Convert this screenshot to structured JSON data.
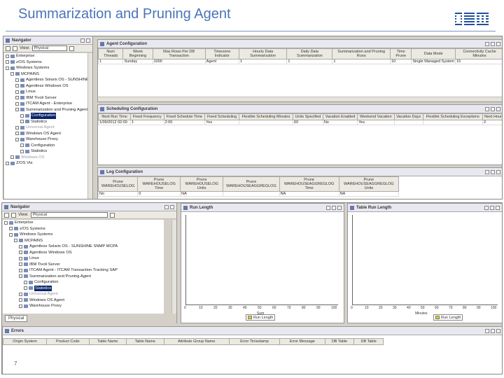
{
  "slide": {
    "title": "Summarization and Pruning Agent",
    "logo": "IBM",
    "page_number": "7"
  },
  "navigator_top": {
    "title": "Navigator",
    "view_label": "View:",
    "view_value": "Physical",
    "tree": [
      {
        "label": "Enterprise",
        "level": 0
      },
      {
        "label": "z/OS Systems",
        "level": 0
      },
      {
        "label": "Windows Systems",
        "level": 0
      },
      {
        "label": "MCPAINS",
        "level": 1
      },
      {
        "label": "Agentless Solaris OS - SUNSHINE",
        "level": 2
      },
      {
        "label": "Agentless Windows OS",
        "level": 2
      },
      {
        "label": "Linux",
        "level": 2
      },
      {
        "label": "IBM Tivoli Server",
        "level": 2
      },
      {
        "label": "ITCAM Agent - Enterprise",
        "level": 2
      },
      {
        "label": "Summarization and Pruning Agent",
        "level": 2
      },
      {
        "label": "Configuration",
        "level": 3,
        "selected": true
      },
      {
        "label": "Statistics",
        "level": 3
      },
      {
        "label": "Universal Agent",
        "level": 2,
        "dim": true
      },
      {
        "label": "Windows OS Agent",
        "level": 2
      },
      {
        "label": "Warehouse Proxy",
        "level": 2
      },
      {
        "label": "Configuration",
        "level": 3
      },
      {
        "label": "Statistics",
        "level": 3
      },
      {
        "label": "Windows OS",
        "level": 1,
        "dim": true
      },
      {
        "label": "Z/OS Vts",
        "level": 0
      }
    ]
  },
  "agent_config": {
    "title": "Agent Configuration",
    "columns": [
      "Num Threads",
      "Week Beginning",
      "Max Rows Per DB Transaction",
      "Timezone Indicator",
      "Hourly Data Summarization",
      "Daily Data Summarization",
      "Summarization and Pruning Runs",
      "Time Prune",
      "Data Mode",
      "Connectivity Cache Minutes"
    ],
    "rows": [
      [
        "1",
        "Sunday",
        "1000",
        "Agent",
        "1",
        "1",
        "1",
        "10",
        "Single Managed System",
        "15"
      ]
    ]
  },
  "sched_config": {
    "title": "Scheduling Configuration",
    "columns": [
      "Next Run Time",
      "Fixed Frequency",
      "Fixed Schedule Time",
      "Fixed Scheduling",
      "Flexible Scheduling Minutes",
      "Units Specified",
      "Vacation Enabled",
      "Weekend Vacation",
      "Vacation Days",
      "Flexible Scheduling Exceptions",
      "Next Hour"
    ],
    "rows": [
      [
        "1/09/2012 02:00",
        "1",
        "2:00",
        "Yes",
        "",
        "60",
        "No",
        "Yes",
        "",
        "",
        "2"
      ]
    ]
  },
  "log_config": {
    "title": "Log Configuration",
    "columns": [
      "Prune WAREHOUSELOG",
      "Prune WAREHOUSELOG Time",
      "Prune WAREHOUSELOG Units",
      "Prune WAREHOUSEAGGREGLOG",
      "Prune WAREHOUSEAGGREGLOG Time",
      "Prune WAREHOUSEAGGREGLOG Units"
    ],
    "rows": [
      [
        "No",
        "0",
        "NA",
        "",
        "NA",
        "NA"
      ]
    ]
  },
  "navigator_bottom": {
    "title": "Navigator",
    "view_label": "View:",
    "view_value": "Physical",
    "tab_label": "Physical",
    "tree": [
      {
        "label": "Enterprise",
        "level": 0
      },
      {
        "label": "z/OS Systems",
        "level": 1
      },
      {
        "label": "Windows Systems",
        "level": 1
      },
      {
        "label": "MCPAINS",
        "level": 2
      },
      {
        "label": "Agentless Solaris OS - SUNSHINE SNMP MCPA",
        "level": 3
      },
      {
        "label": "Agentless Windows OS",
        "level": 3
      },
      {
        "label": "Linux",
        "level": 3
      },
      {
        "label": "IBM Tivoli Server",
        "level": 3
      },
      {
        "label": "ITCAM Agent - ITCAM Transaction Tracking SAP",
        "level": 3
      },
      {
        "label": "Summarization and Pruning Agent",
        "level": 3
      },
      {
        "label": "Configuration",
        "level": 4
      },
      {
        "label": "Statistics",
        "level": 4,
        "selected": true
      },
      {
        "label": "Universal Agent",
        "level": 3,
        "dim": true
      },
      {
        "label": "Windows OS Agent",
        "level": 3
      },
      {
        "label": "Warehouse Proxy",
        "level": 3
      }
    ]
  },
  "run_length_chart": {
    "title": "Run Length",
    "xlabel": "Sum",
    "legend": "Run Length",
    "x_ticks": [
      "0",
      "10",
      "20",
      "30",
      "40",
      "50",
      "60",
      "70",
      "80",
      "90",
      "100"
    ]
  },
  "table_run_length_chart": {
    "title": "Table Run Length",
    "xlabel": "Minutes",
    "legend": "Run Length",
    "x_ticks": [
      "0",
      "10",
      "20",
      "30",
      "40",
      "50",
      "60",
      "70",
      "80",
      "90",
      "100"
    ]
  },
  "errors": {
    "title": "Errors",
    "columns": [
      "Origin System",
      "Product Code",
      "Table Name",
      "Table Name",
      "Attribute Group Name",
      "Error Timestamp",
      "Error Message",
      "DB Table",
      "DB Table"
    ]
  }
}
